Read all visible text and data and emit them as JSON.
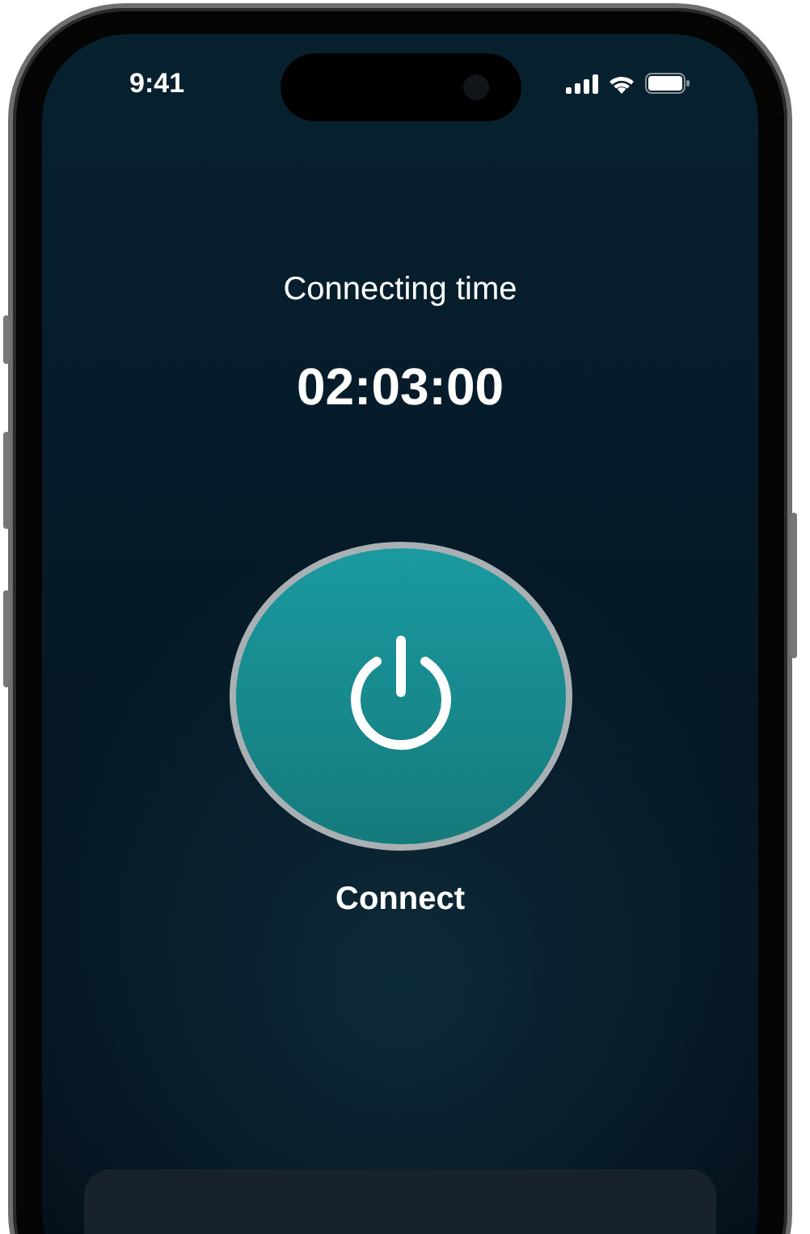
{
  "status_bar": {
    "time": "9:41"
  },
  "title": "Connecting time",
  "timer": "02:03:00",
  "connect_button": {
    "label": "Connect"
  }
}
